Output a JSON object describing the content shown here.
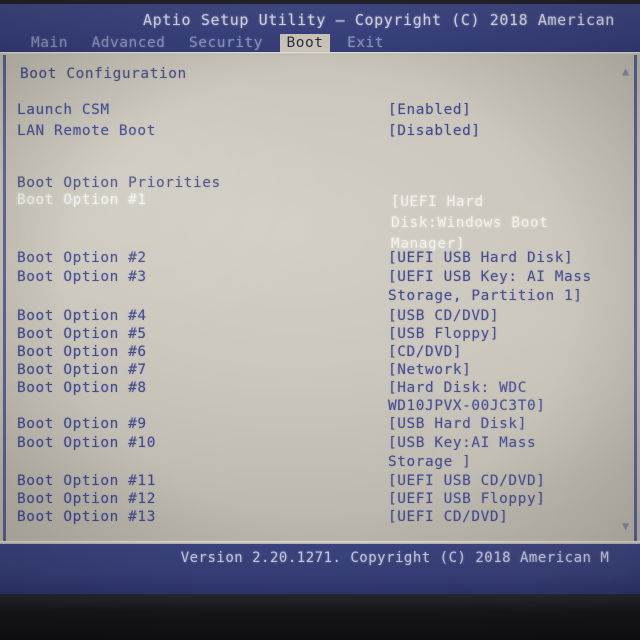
{
  "header": {
    "title": "Aptio Setup Utility – Copyright (C) 2018 American",
    "blue": "#3b4380"
  },
  "tabs": [
    {
      "label": "Main",
      "active": false
    },
    {
      "label": "Advanced",
      "active": false
    },
    {
      "label": "Security",
      "active": false
    },
    {
      "label": "Boot",
      "active": true
    },
    {
      "label": "Exit",
      "active": false
    }
  ],
  "main": {
    "section_title": "Boot Configuration",
    "priorities_title": "Boot Option Priorities",
    "settings": [
      {
        "label": "Launch CSM",
        "value": "[Enabled]",
        "selected": false
      },
      {
        "label": "LAN Remote Boot",
        "value": "[Disabled]",
        "selected": false
      }
    ],
    "boot_options": [
      {
        "label": "Boot Option #1",
        "value": "[UEFI Hard Disk:Windows Boot Manager]",
        "selected": true
      },
      {
        "label": "Boot Option #2",
        "value": "[UEFI USB Hard Disk]",
        "selected": false
      },
      {
        "label": "Boot Option #3",
        "value": "[UEFI USB Key: AI Mass Storage, Partition 1]",
        "selected": false
      },
      {
        "label": "Boot Option #4",
        "value": "[USB CD/DVD]",
        "selected": false
      },
      {
        "label": "Boot Option #5",
        "value": "[USB Floppy]",
        "selected": false
      },
      {
        "label": "Boot Option #6",
        "value": "[CD/DVD]",
        "selected": false
      },
      {
        "label": "Boot Option #7",
        "value": "[Network]",
        "selected": false
      },
      {
        "label": "Boot Option #8",
        "value": "[Hard Disk: WDC WD10JPVX-00JC3T0]",
        "selected": false
      },
      {
        "label": "Boot Option #9",
        "value": "[USB Hard Disk]",
        "selected": false
      },
      {
        "label": "Boot Option #10",
        "value": "[USB Key:AI Mass Storage ]",
        "selected": false
      },
      {
        "label": "Boot Option #11",
        "value": "[UEFI USB CD/DVD]",
        "selected": false
      },
      {
        "label": "Boot Option #12",
        "value": "[UEFI USB Floppy]",
        "selected": false
      },
      {
        "label": "Boot Option #13",
        "value": "[UEFI CD/DVD]",
        "selected": false
      }
    ],
    "value_lines": {
      "opt1_l1": "[UEFI Hard",
      "opt1_l2": "Disk:Windows Boot",
      "opt1_l3": "Manager]",
      "opt2": "[UEFI USB Hard Disk]",
      "opt3_l1": "[UEFI USB Key: AI Mass",
      "opt3_l2": "Storage, Partition 1]",
      "opt4": "[USB CD/DVD]",
      "opt5": "[USB Floppy]",
      "opt6": "[CD/DVD]",
      "opt7": "[Network]",
      "opt8_l1": "[Hard Disk: WDC",
      "opt8_l2": "WD10JPVX-00JC3T0]",
      "opt9": "[USB Hard Disk]",
      "opt10_l1": "[USB Key:AI Mass",
      "opt10_l2": "Storage ]",
      "opt11": "[UEFI USB CD/DVD]",
      "opt12": "[UEFI USB Floppy]",
      "opt13": "[UEFI CD/DVD]"
    },
    "scroll_up": "▲",
    "scroll_down": "▼"
  },
  "footer": {
    "text": "Version 2.20.1271. Copyright (C) 2018 American M"
  }
}
